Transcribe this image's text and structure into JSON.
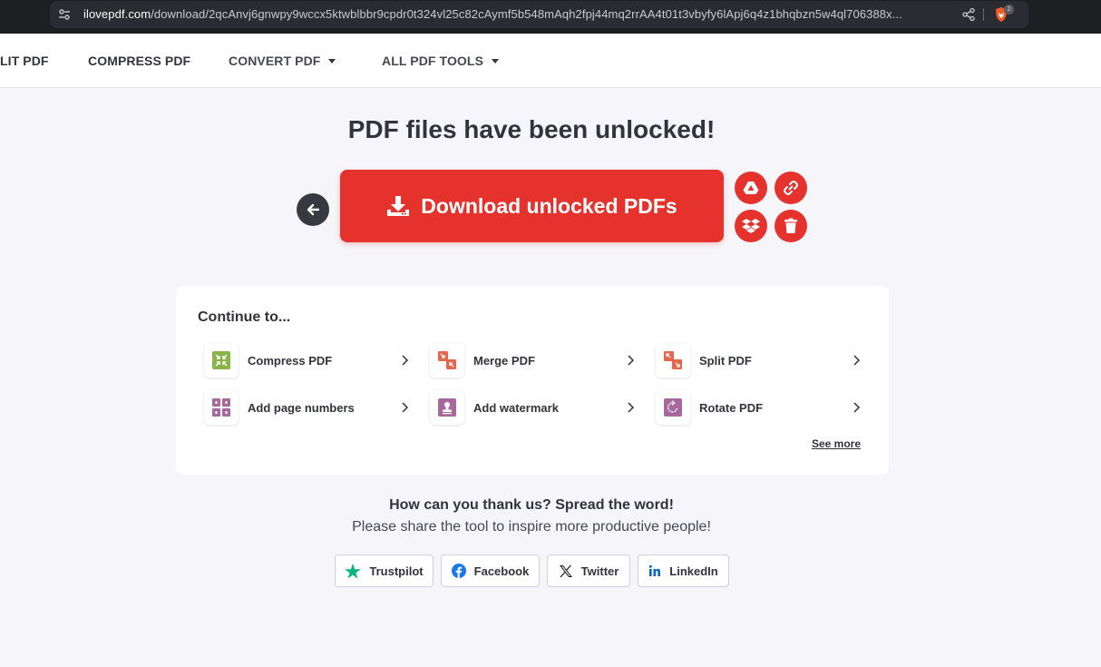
{
  "browser": {
    "url_host": "ilovepdf.com",
    "url_path": "/download/2qcAnvj6gnwpy9wccx5ktwblbbr9cpdr0t324vl25c82cAymf5b548mAqh2fpj44mq2rrAA4t01t3vbyfy6lApj6q4z1bhqbzn5w4ql706388x...",
    "extension_badge": "2"
  },
  "nav": {
    "split": "LIT PDF",
    "compress": "COMPRESS PDF",
    "convert": "CONVERT PDF",
    "all_tools": "ALL PDF TOOLS"
  },
  "main": {
    "title": "PDF files have been unlocked!",
    "download_label": "Download unlocked PDFs"
  },
  "continue": {
    "title": "Continue to...",
    "tools": [
      {
        "label": "Compress PDF",
        "icon": "compress-icon",
        "color": "#8bb448"
      },
      {
        "label": "Merge PDF",
        "icon": "merge-icon",
        "color": "#e5664a"
      },
      {
        "label": "Split PDF",
        "icon": "split-icon",
        "color": "#e5664a"
      },
      {
        "label": "Add page numbers",
        "icon": "page-numbers-icon",
        "color": "#a8689e"
      },
      {
        "label": "Add watermark",
        "icon": "watermark-icon",
        "color": "#a8689e"
      },
      {
        "label": "Rotate PDF",
        "icon": "rotate-icon",
        "color": "#a8689e"
      }
    ],
    "see_more": "See more"
  },
  "share": {
    "heading": "How can you thank us? Spread the word!",
    "subheading": "Please share the tool to inspire more productive people!",
    "buttons": [
      {
        "label": "Trustpilot",
        "icon": "trustpilot-star-icon"
      },
      {
        "label": "Facebook",
        "icon": "facebook-icon"
      },
      {
        "label": "Twitter",
        "icon": "x-twitter-icon"
      },
      {
        "label": "LinkedIn",
        "icon": "linkedin-icon"
      }
    ]
  },
  "colors": {
    "brand_red": "#e5322d",
    "dark": "#33333b",
    "background": "#f5f5fa"
  }
}
